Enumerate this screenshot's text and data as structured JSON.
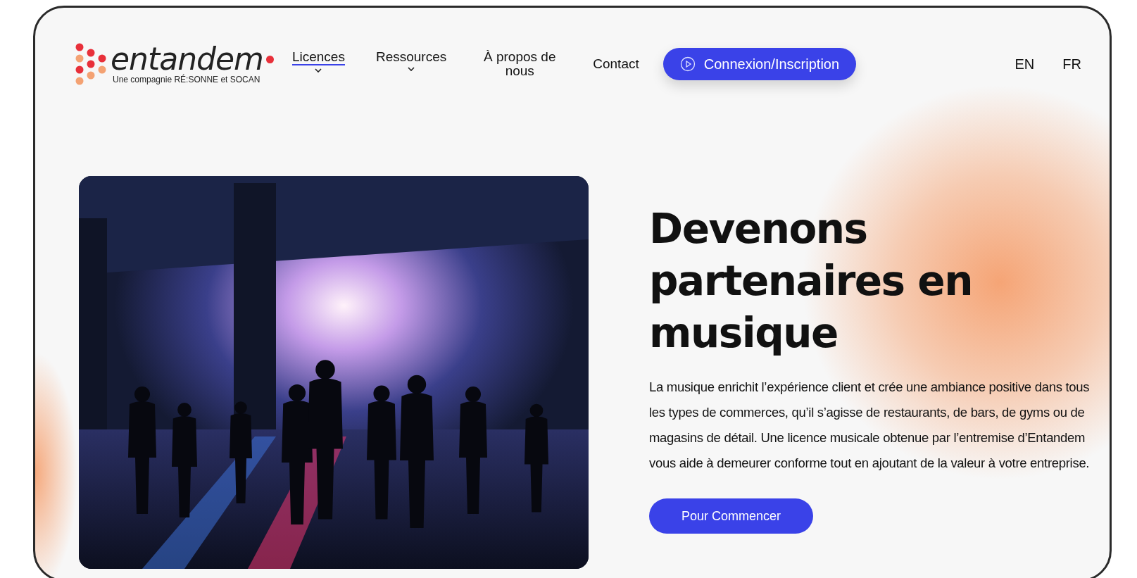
{
  "logo": {
    "wordmark": "entandem",
    "tagline": "Une compagnie RÉ:SONNE et SOCAN"
  },
  "nav": [
    {
      "label": "Licences",
      "kind": "dropdown",
      "selected": true
    },
    {
      "label": "Ressources",
      "kind": "dropdown",
      "selected": false
    },
    {
      "label": "À propos de nous",
      "kind": "link",
      "selected": false
    },
    {
      "label": "Contact",
      "kind": "link",
      "selected": false
    }
  ],
  "login_button": {
    "label": "Connexion/Inscription"
  },
  "languages": [
    "EN",
    "FR"
  ],
  "hero": {
    "heading": "Devenons partenaires en musique",
    "body": "La musique enrichit l’expérience client et crée une ambiance positive dans tous les types de commerces, qu’il s’agisse de restaurants, de bars, de gyms ou de magasins de détail. Une licence musicale obtenue par l’entremise d’Entandem vous aide à demeurer conforme tout en ajoutant de la valeur à votre entreprise.",
    "cta": "Pour Commencer"
  }
}
